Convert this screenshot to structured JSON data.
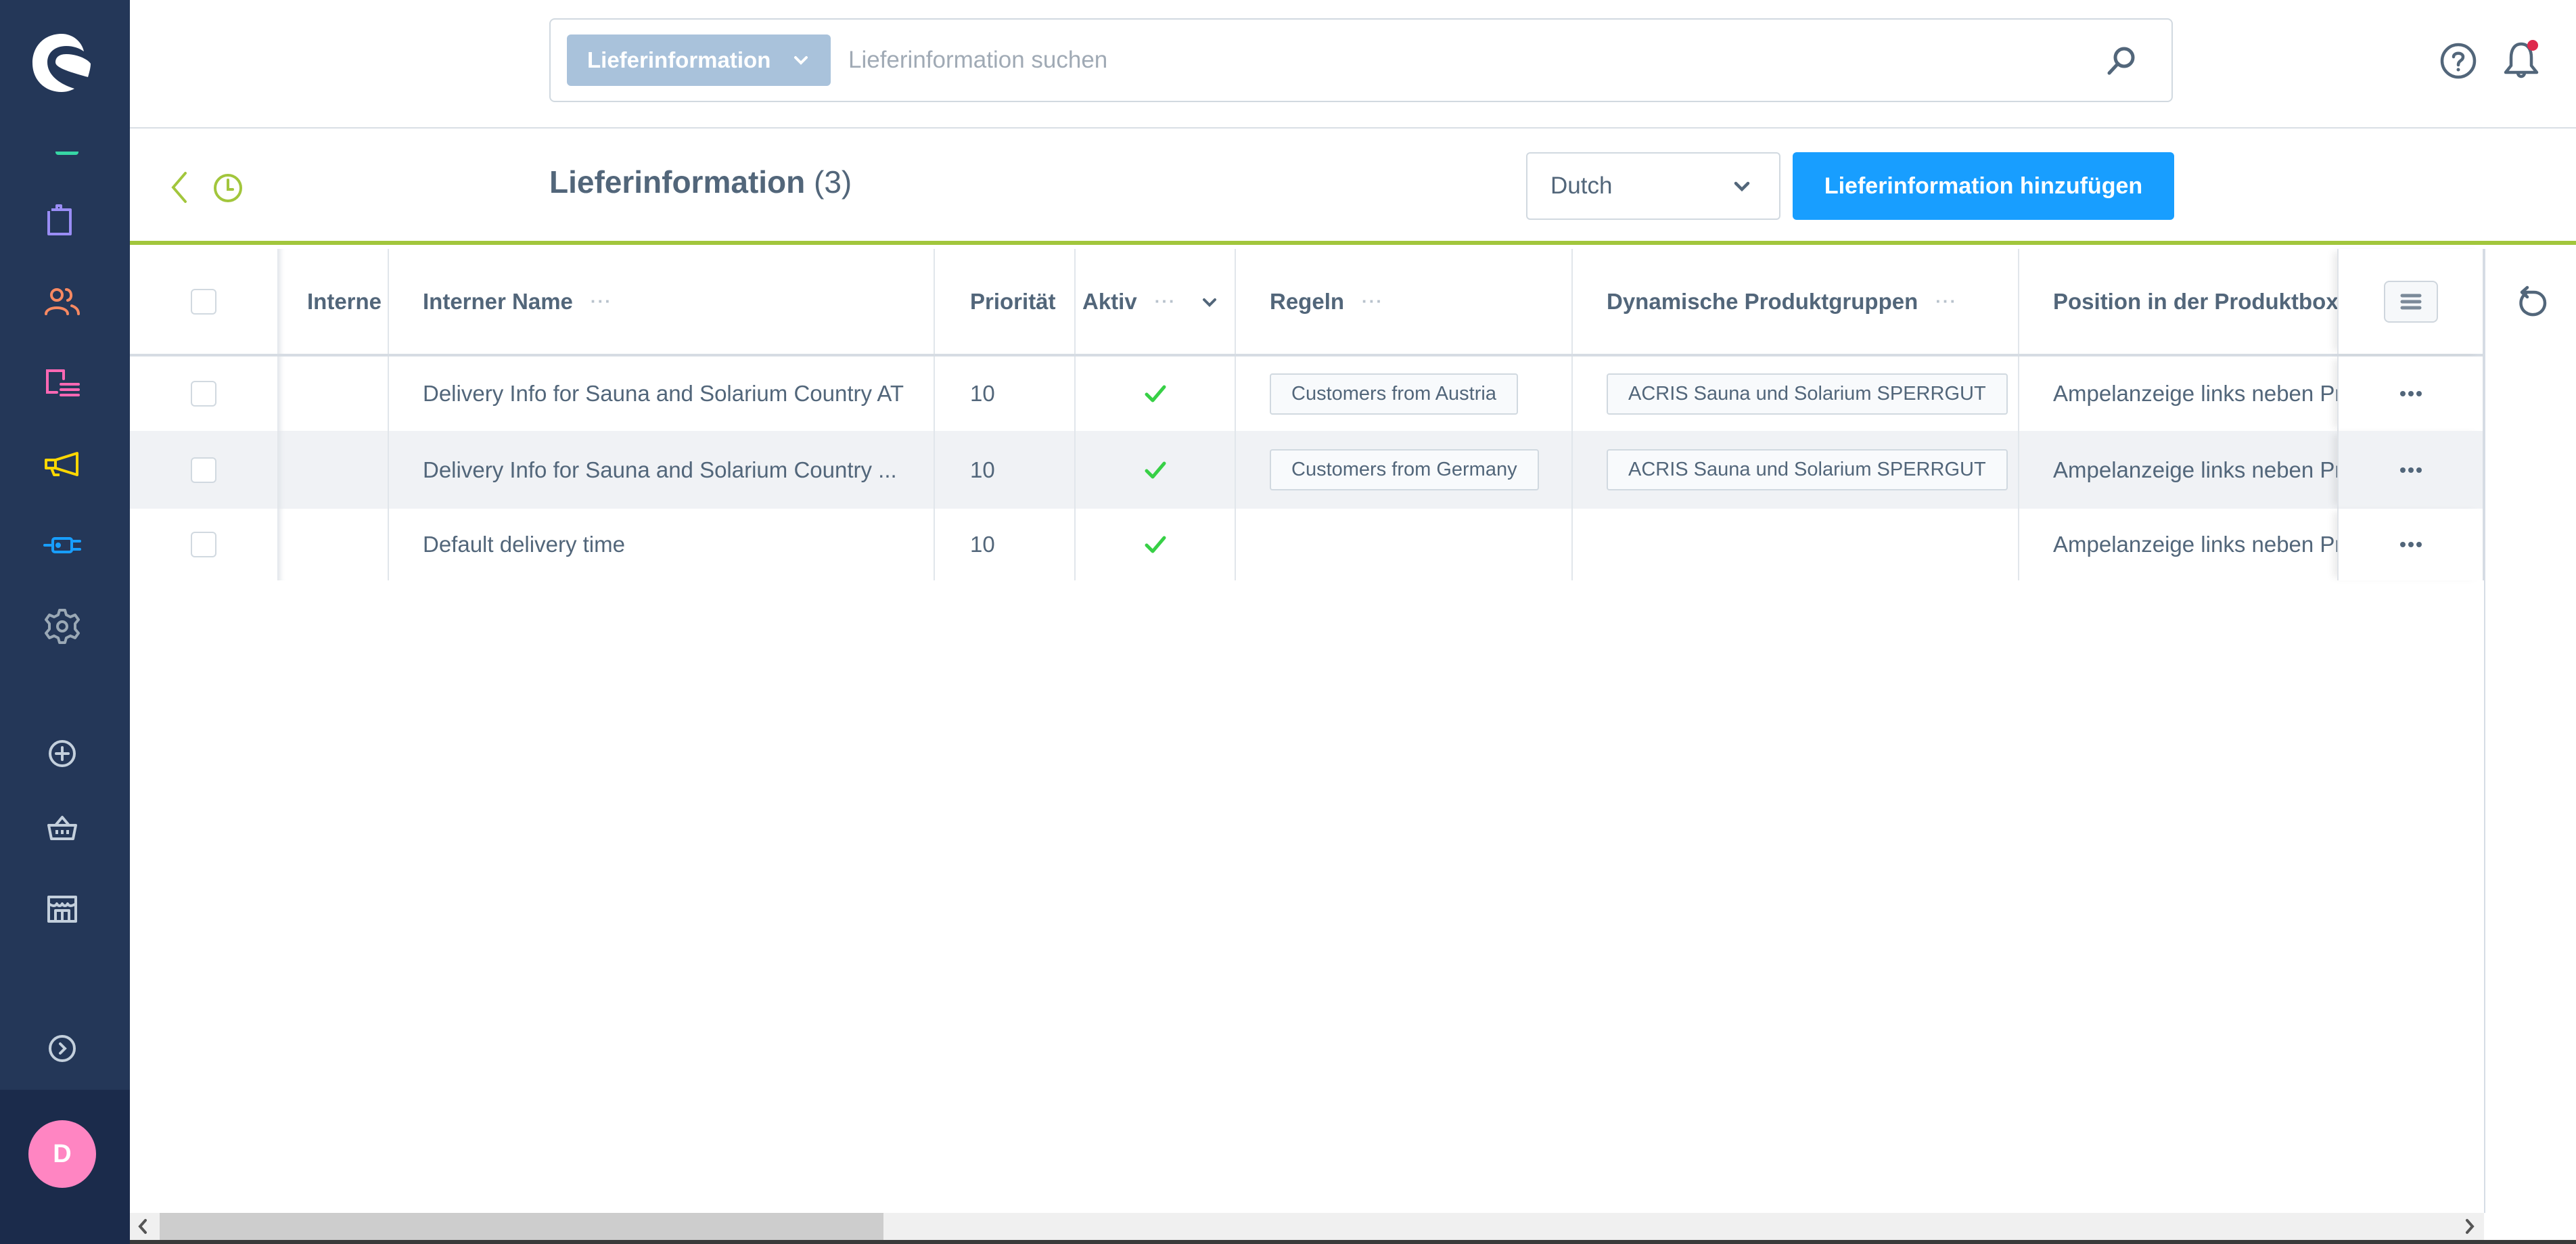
{
  "sidebar": {
    "logo": "shopware-logo",
    "active_indicator_color": "#37d6a5",
    "nav_items": [
      {
        "name": "catalog",
        "icon": "shopping-bag-icon",
        "color": "#9a8df5"
      },
      {
        "name": "customers",
        "icon": "users-icon",
        "color": "#f88962"
      },
      {
        "name": "content",
        "icon": "content-icon",
        "color": "#ff68b4"
      },
      {
        "name": "marketing",
        "icon": "megaphone-icon",
        "color": "#ffd700"
      },
      {
        "name": "extensions",
        "icon": "plug-icon",
        "color": "#189eff"
      },
      {
        "name": "settings",
        "icon": "gear-icon",
        "color": "#9aa8b5"
      }
    ],
    "sales_channels": [
      {
        "name": "add-sales-channel",
        "icon": "plus-circle-icon"
      },
      {
        "name": "storefront",
        "icon": "basket-icon"
      },
      {
        "name": "headless",
        "icon": "shop-icon"
      }
    ],
    "expand_icon": "chevron-circle-right-icon",
    "user": {
      "initial": "D",
      "avatar_color": "#ff85c2"
    }
  },
  "header": {
    "search": {
      "type_label": "Lieferinformation",
      "placeholder": "Lieferinformation suchen",
      "value": ""
    },
    "help_icon": "help-icon",
    "notifications": {
      "icon": "bell-icon",
      "has_unread": true,
      "badge_color": "#de294c"
    }
  },
  "page": {
    "title": "Lieferinformation",
    "count": "(3)",
    "language_select": {
      "value": "Dutch"
    },
    "add_button_label": "Lieferinformation hinzufügen",
    "accent_color": "#a2c63c",
    "primary_color": "#189eff"
  },
  "table": {
    "columns": [
      {
        "key": "internal_truncated",
        "label": "Interne"
      },
      {
        "key": "internal_name",
        "label": "Interner Name"
      },
      {
        "key": "priority",
        "label": "Priorität"
      },
      {
        "key": "active",
        "label": "Aktiv"
      },
      {
        "key": "rules",
        "label": "Regeln"
      },
      {
        "key": "dynamic_groups",
        "label": "Dynamische Produktgruppen"
      },
      {
        "key": "position",
        "label": "Position in der Produktbox"
      }
    ],
    "column_menu_glyph": "···",
    "rows": [
      {
        "internal_name": "Delivery Info for Sauna and Solarium Country AT",
        "priority": "10",
        "active": true,
        "rules": "Customers from Austria",
        "dynamic_groups": "ACRIS Sauna und Solarium SPERRGUT",
        "position": "Ampelanzeige links neben Pr"
      },
      {
        "internal_name": "Delivery Info for Sauna and Solarium Country ...",
        "priority": "10",
        "active": true,
        "rules": "Customers from Germany",
        "dynamic_groups": "ACRIS Sauna und Solarium SPERRGUT",
        "position": "Ampelanzeige links neben Pr"
      },
      {
        "internal_name": "Default delivery time",
        "priority": "10",
        "active": true,
        "rules": "",
        "dynamic_groups": "",
        "position": "Ampelanzeige links neben Pr"
      }
    ],
    "active_check_color": "#37d046"
  },
  "scrollbar": {
    "horizontal_position_fraction": 0.0,
    "visible_fraction": 0.31
  }
}
